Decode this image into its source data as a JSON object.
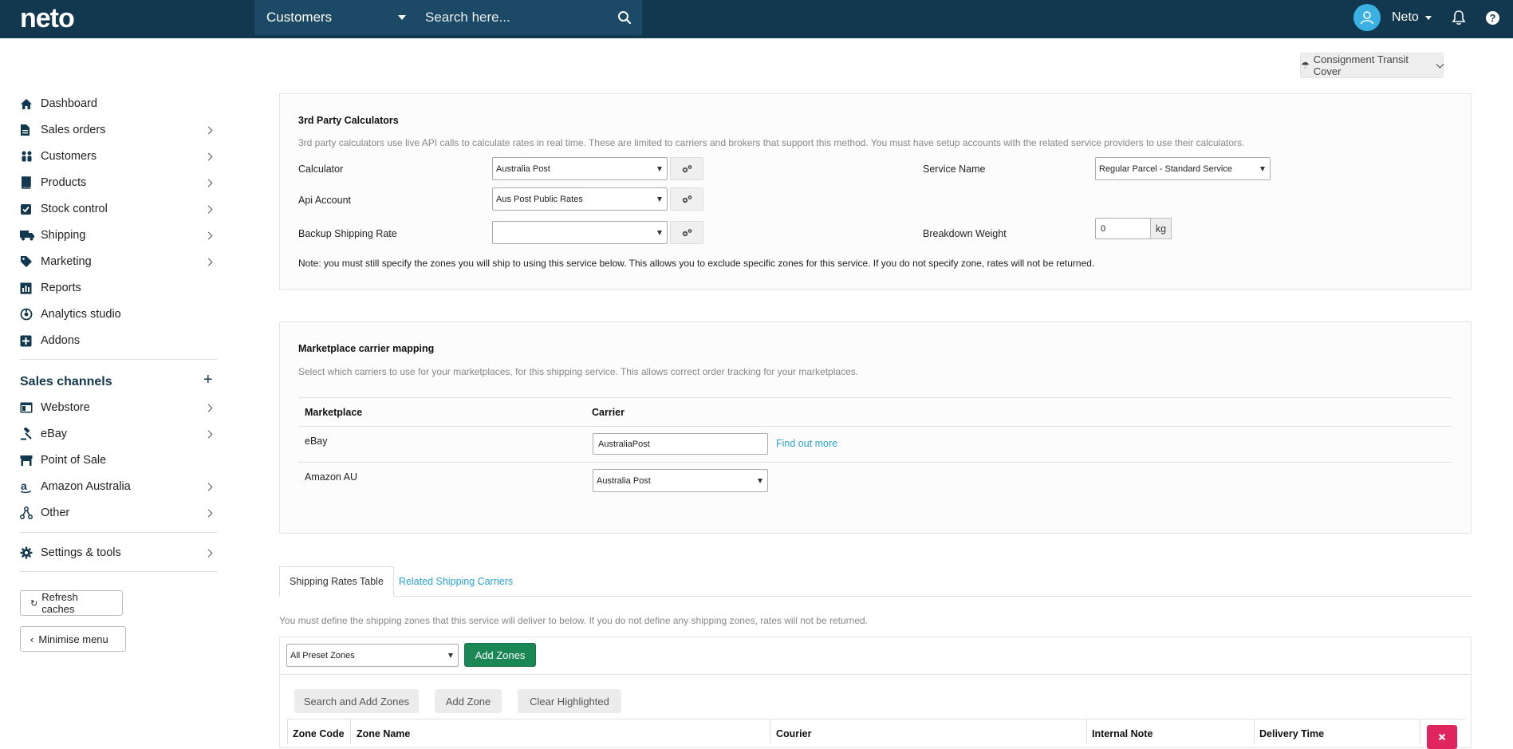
{
  "topbar": {
    "logo": "neto",
    "search_scope": "Customers",
    "search_placeholder": "Search here...",
    "user_name": "Neto"
  },
  "sidebar": {
    "items": [
      {
        "label": "Dashboard",
        "icon": "home-icon"
      },
      {
        "label": "Sales orders",
        "icon": "document-icon"
      },
      {
        "label": "Customers",
        "icon": "users-icon"
      },
      {
        "label": "Products",
        "icon": "book-icon"
      },
      {
        "label": "Stock control",
        "icon": "checkbox-icon"
      },
      {
        "label": "Shipping",
        "icon": "truck-icon"
      },
      {
        "label": "Marketing",
        "icon": "tag-icon"
      },
      {
        "label": "Reports",
        "icon": "bar-chart-icon"
      },
      {
        "label": "Analytics studio",
        "icon": "analytics-icon"
      },
      {
        "label": "Addons",
        "icon": "plus-square-icon"
      }
    ],
    "channels_title": "Sales channels",
    "channels": [
      {
        "label": "Webstore",
        "icon": "webstore-icon"
      },
      {
        "label": "eBay",
        "icon": "gavel-icon"
      },
      {
        "label": "Point of Sale",
        "icon": "store-icon"
      },
      {
        "label": "Amazon Australia",
        "icon": "amazon-icon"
      },
      {
        "label": "Other",
        "icon": "share-icon"
      }
    ],
    "settings_label": "Settings & tools",
    "refresh_label": "Refresh caches",
    "minimise_label": "Minimise menu"
  },
  "main": {
    "transit_cover_label": "Consignment Transit Cover",
    "calculators": {
      "title": "3rd Party Calculators",
      "description": "3rd party calculators use live API calls to calculate rates in real time. These are limited to carriers and brokers that support this method. You must have setup accounts with the related service providers to use their calculators.",
      "calculator_label": "Calculator",
      "calculator_value": "Australia Post",
      "api_account_label": "Api Account",
      "api_account_value": "Aus Post Public Rates",
      "backup_label": "Backup Shipping Rate",
      "backup_value": "",
      "service_name_label": "Service Name",
      "service_name_value": "Regular Parcel - Standard Service",
      "breakdown_label": "Breakdown Weight",
      "breakdown_value": "0",
      "breakdown_unit": "kg",
      "note": "Note: you must still specify the zones you will ship to using this service below. This allows you to exclude specific zones for this service. If you do not specify zone, rates will not be returned."
    },
    "marketplace": {
      "title": "Marketplace carrier mapping",
      "description": "Select which carriers to use for your marketplaces, for this shipping service. This allows correct order tracking for your marketplaces.",
      "col_marketplace": "Marketplace",
      "col_carrier": "Carrier",
      "rows": [
        {
          "marketplace": "eBay",
          "carrier": "AustraliaPost",
          "link": "Find out more"
        },
        {
          "marketplace": "Amazon AU",
          "carrier": "Australia Post"
        }
      ]
    },
    "tabs": [
      {
        "label": "Shipping Rates Table"
      },
      {
        "label": "Related Shipping Carriers"
      }
    ],
    "zones_note": "You must define the shipping zones that this service will deliver to below. If you do not define any shipping zones, rates will not be returned.",
    "zone_preset_value": "All Preset Zones",
    "add_zones_label": "Add Zones",
    "search_add_zones_label": "Search and Add Zones",
    "add_zone_label": "Add Zone",
    "clear_highlighted_label": "Clear Highlighted",
    "zone_table_headers": [
      "Zone Code",
      "Zone Name",
      "Courier",
      "Internal Note",
      "Delivery Time"
    ]
  }
}
